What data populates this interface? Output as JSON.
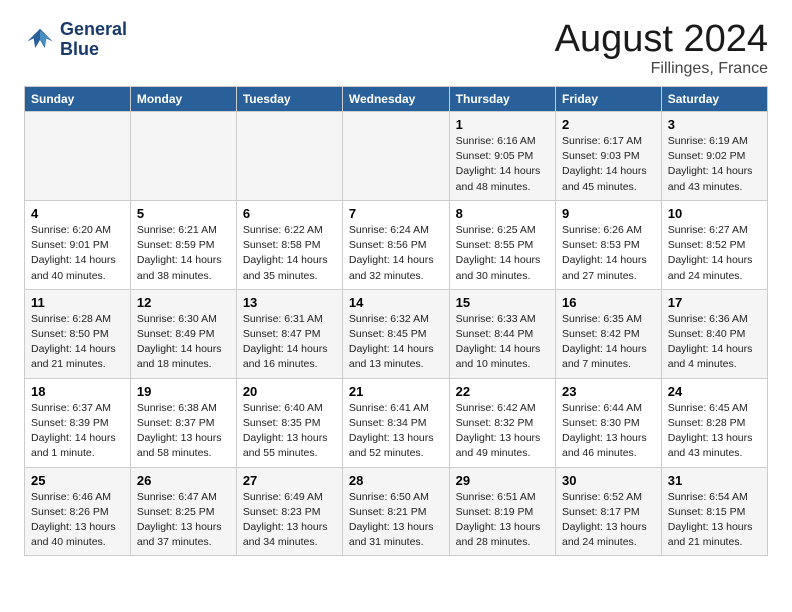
{
  "header": {
    "logo_line1": "General",
    "logo_line2": "Blue",
    "month_title": "August 2024",
    "location": "Fillinges, France"
  },
  "weekdays": [
    "Sunday",
    "Monday",
    "Tuesday",
    "Wednesday",
    "Thursday",
    "Friday",
    "Saturday"
  ],
  "weeks": [
    [
      {
        "day": "",
        "detail": ""
      },
      {
        "day": "",
        "detail": ""
      },
      {
        "day": "",
        "detail": ""
      },
      {
        "day": "",
        "detail": ""
      },
      {
        "day": "1",
        "detail": "Sunrise: 6:16 AM\nSunset: 9:05 PM\nDaylight: 14 hours\nand 48 minutes."
      },
      {
        "day": "2",
        "detail": "Sunrise: 6:17 AM\nSunset: 9:03 PM\nDaylight: 14 hours\nand 45 minutes."
      },
      {
        "day": "3",
        "detail": "Sunrise: 6:19 AM\nSunset: 9:02 PM\nDaylight: 14 hours\nand 43 minutes."
      }
    ],
    [
      {
        "day": "4",
        "detail": "Sunrise: 6:20 AM\nSunset: 9:01 PM\nDaylight: 14 hours\nand 40 minutes."
      },
      {
        "day": "5",
        "detail": "Sunrise: 6:21 AM\nSunset: 8:59 PM\nDaylight: 14 hours\nand 38 minutes."
      },
      {
        "day": "6",
        "detail": "Sunrise: 6:22 AM\nSunset: 8:58 PM\nDaylight: 14 hours\nand 35 minutes."
      },
      {
        "day": "7",
        "detail": "Sunrise: 6:24 AM\nSunset: 8:56 PM\nDaylight: 14 hours\nand 32 minutes."
      },
      {
        "day": "8",
        "detail": "Sunrise: 6:25 AM\nSunset: 8:55 PM\nDaylight: 14 hours\nand 30 minutes."
      },
      {
        "day": "9",
        "detail": "Sunrise: 6:26 AM\nSunset: 8:53 PM\nDaylight: 14 hours\nand 27 minutes."
      },
      {
        "day": "10",
        "detail": "Sunrise: 6:27 AM\nSunset: 8:52 PM\nDaylight: 14 hours\nand 24 minutes."
      }
    ],
    [
      {
        "day": "11",
        "detail": "Sunrise: 6:28 AM\nSunset: 8:50 PM\nDaylight: 14 hours\nand 21 minutes."
      },
      {
        "day": "12",
        "detail": "Sunrise: 6:30 AM\nSunset: 8:49 PM\nDaylight: 14 hours\nand 18 minutes."
      },
      {
        "day": "13",
        "detail": "Sunrise: 6:31 AM\nSunset: 8:47 PM\nDaylight: 14 hours\nand 16 minutes."
      },
      {
        "day": "14",
        "detail": "Sunrise: 6:32 AM\nSunset: 8:45 PM\nDaylight: 14 hours\nand 13 minutes."
      },
      {
        "day": "15",
        "detail": "Sunrise: 6:33 AM\nSunset: 8:44 PM\nDaylight: 14 hours\nand 10 minutes."
      },
      {
        "day": "16",
        "detail": "Sunrise: 6:35 AM\nSunset: 8:42 PM\nDaylight: 14 hours\nand 7 minutes."
      },
      {
        "day": "17",
        "detail": "Sunrise: 6:36 AM\nSunset: 8:40 PM\nDaylight: 14 hours\nand 4 minutes."
      }
    ],
    [
      {
        "day": "18",
        "detail": "Sunrise: 6:37 AM\nSunset: 8:39 PM\nDaylight: 14 hours\nand 1 minute."
      },
      {
        "day": "19",
        "detail": "Sunrise: 6:38 AM\nSunset: 8:37 PM\nDaylight: 13 hours\nand 58 minutes."
      },
      {
        "day": "20",
        "detail": "Sunrise: 6:40 AM\nSunset: 8:35 PM\nDaylight: 13 hours\nand 55 minutes."
      },
      {
        "day": "21",
        "detail": "Sunrise: 6:41 AM\nSunset: 8:34 PM\nDaylight: 13 hours\nand 52 minutes."
      },
      {
        "day": "22",
        "detail": "Sunrise: 6:42 AM\nSunset: 8:32 PM\nDaylight: 13 hours\nand 49 minutes."
      },
      {
        "day": "23",
        "detail": "Sunrise: 6:44 AM\nSunset: 8:30 PM\nDaylight: 13 hours\nand 46 minutes."
      },
      {
        "day": "24",
        "detail": "Sunrise: 6:45 AM\nSunset: 8:28 PM\nDaylight: 13 hours\nand 43 minutes."
      }
    ],
    [
      {
        "day": "25",
        "detail": "Sunrise: 6:46 AM\nSunset: 8:26 PM\nDaylight: 13 hours\nand 40 minutes."
      },
      {
        "day": "26",
        "detail": "Sunrise: 6:47 AM\nSunset: 8:25 PM\nDaylight: 13 hours\nand 37 minutes."
      },
      {
        "day": "27",
        "detail": "Sunrise: 6:49 AM\nSunset: 8:23 PM\nDaylight: 13 hours\nand 34 minutes."
      },
      {
        "day": "28",
        "detail": "Sunrise: 6:50 AM\nSunset: 8:21 PM\nDaylight: 13 hours\nand 31 minutes."
      },
      {
        "day": "29",
        "detail": "Sunrise: 6:51 AM\nSunset: 8:19 PM\nDaylight: 13 hours\nand 28 minutes."
      },
      {
        "day": "30",
        "detail": "Sunrise: 6:52 AM\nSunset: 8:17 PM\nDaylight: 13 hours\nand 24 minutes."
      },
      {
        "day": "31",
        "detail": "Sunrise: 6:54 AM\nSunset: 8:15 PM\nDaylight: 13 hours\nand 21 minutes."
      }
    ]
  ]
}
